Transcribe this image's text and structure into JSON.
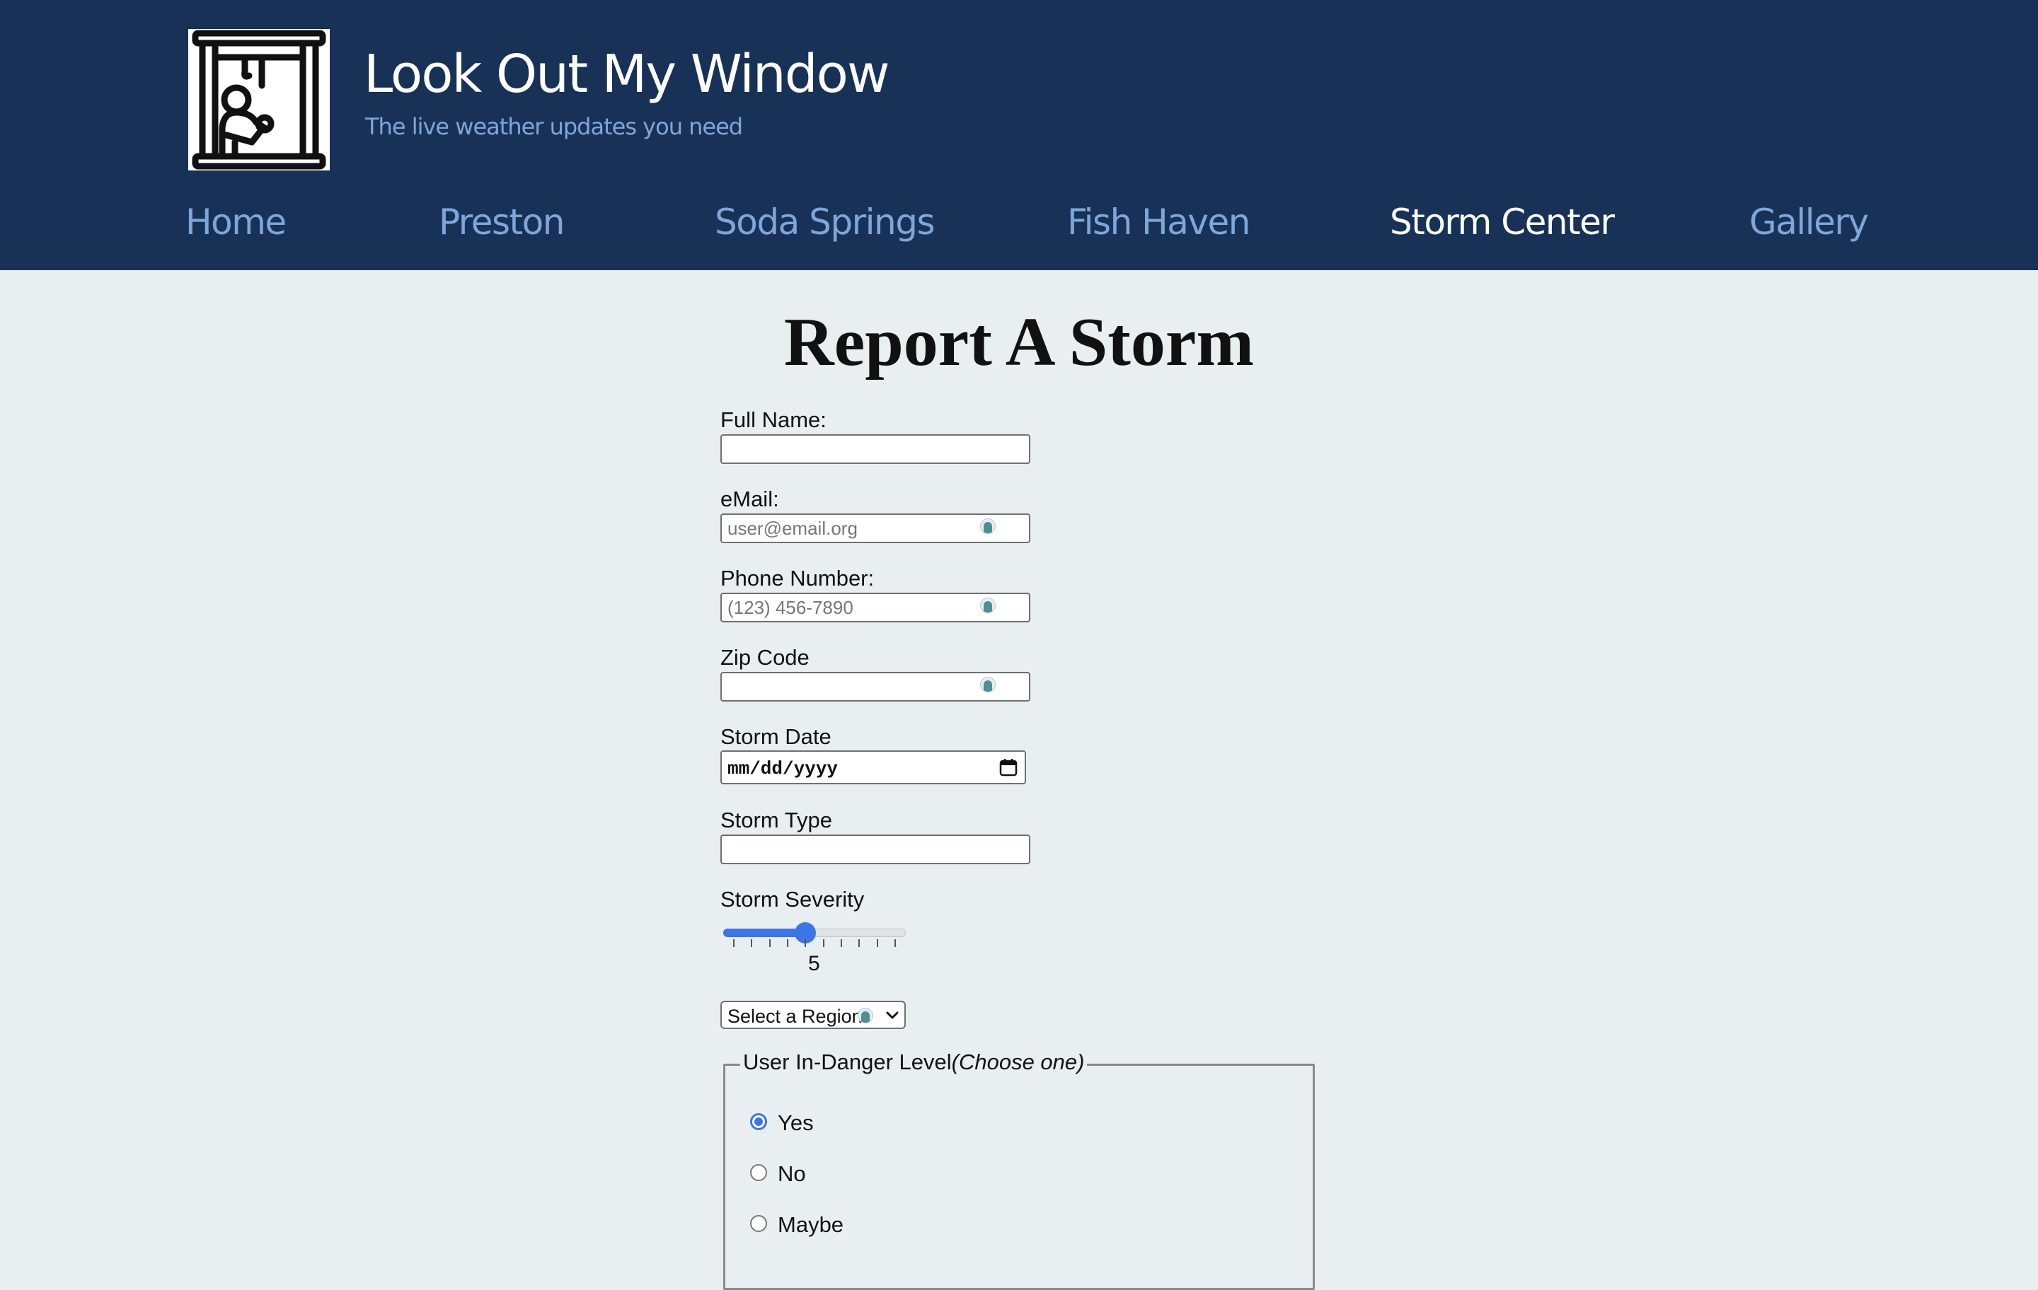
{
  "header": {
    "title": "Look Out My Window",
    "tagline": "The live weather updates you need",
    "logo_icon": "person-at-window-icon"
  },
  "nav": [
    {
      "label": "Home",
      "active": false
    },
    {
      "label": "Preston",
      "active": false
    },
    {
      "label": "Soda Springs",
      "active": false
    },
    {
      "label": "Fish Haven",
      "active": false
    },
    {
      "label": "Storm Center",
      "active": true
    },
    {
      "label": "Gallery",
      "active": false
    }
  ],
  "main": {
    "title": "Report A Storm"
  },
  "form": {
    "full_name": {
      "label": "Full Name:",
      "value": "",
      "placeholder": ""
    },
    "email": {
      "label": "eMail:",
      "value": "",
      "placeholder": "user@email.org"
    },
    "phone": {
      "label": "Phone Number:",
      "value": "",
      "placeholder": "(123) 456-7890"
    },
    "zip": {
      "label": "Zip Code",
      "value": "",
      "placeholder": ""
    },
    "storm_date": {
      "label": "Storm Date",
      "display": "mm/dd/yyyy"
    },
    "storm_type": {
      "label": "Storm Type",
      "value": ""
    },
    "storm_severity": {
      "label": "Storm Severity",
      "value": "5",
      "min": 1,
      "max": 10
    },
    "region": {
      "selected": "Select a Region..."
    },
    "danger": {
      "legend": "User In-Danger Level",
      "legend_hint": "(Choose one)",
      "options": [
        {
          "label": "Yes",
          "checked": true
        },
        {
          "label": "No",
          "checked": false
        },
        {
          "label": "Maybe",
          "checked": false
        }
      ]
    }
  },
  "colors": {
    "header_bg": "#183257",
    "nav_link": "#7fa6d9",
    "nav_active": "#ffffff",
    "page_bg": "#e9eef1",
    "accent": "#3b76e8"
  }
}
